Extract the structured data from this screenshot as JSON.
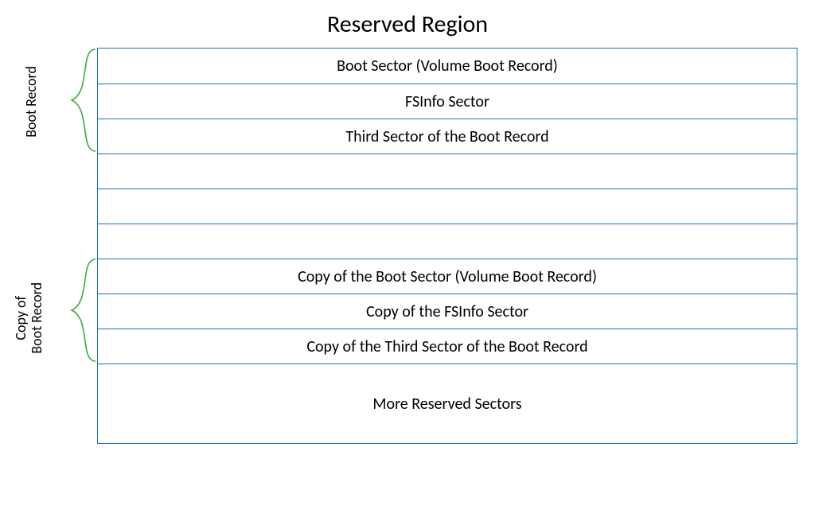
{
  "title": "Reserved Region",
  "labels": {
    "bootRecord": "Boot Record",
    "copyBootRecord1": "Copy of",
    "copyBootRecord2": "Boot Record"
  },
  "rows": {
    "r0": "Boot Sector (Volume Boot Record)",
    "r1": "FSInfo Sector",
    "r2": "Third Sector of the Boot Record",
    "r3": "",
    "r4": "",
    "r5": "",
    "r6": "Copy of the Boot Sector (Volume Boot Record)",
    "r7": "Copy of the FSInfo Sector",
    "r8": "Copy of the Third Sector of the Boot Record",
    "r9": "More Reserved Sectors"
  },
  "colors": {
    "border": "#1f6fc2",
    "brace": "#3faa3f",
    "text": "#000000"
  }
}
